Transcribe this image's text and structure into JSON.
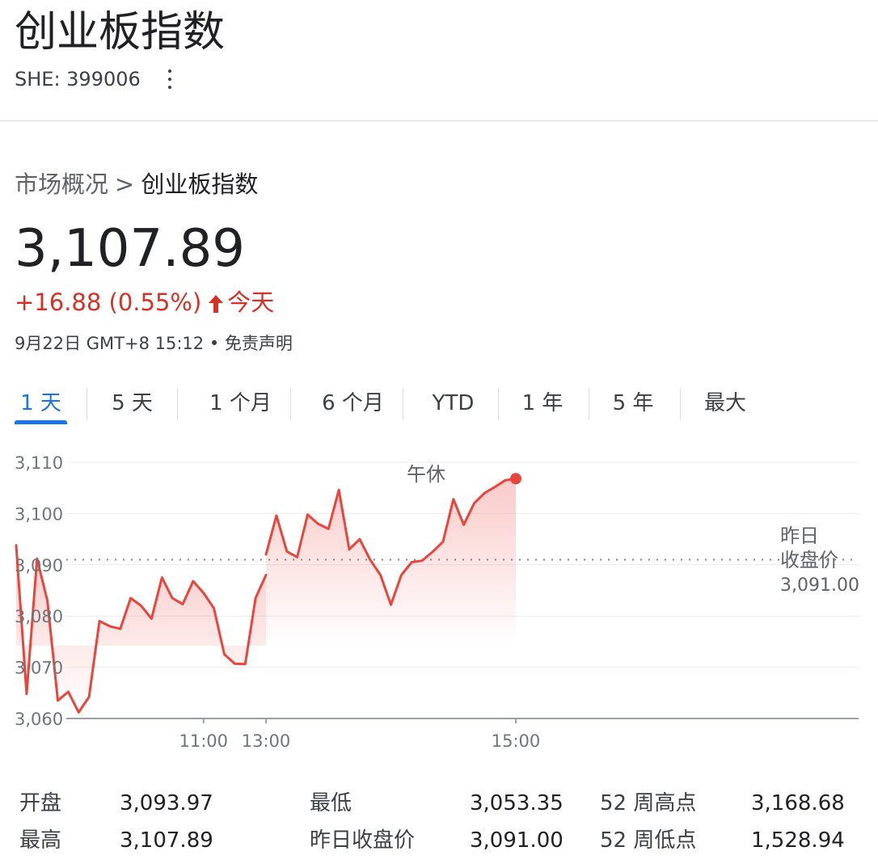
{
  "header": {
    "title": "创业板指数",
    "ticker": "SHE: 399006"
  },
  "breadcrumb": {
    "parent": "市场概况",
    "separator": ">",
    "current": "创业板指数"
  },
  "quote": {
    "price": "3,107.89",
    "change": "+16.88 (0.55%)",
    "period": "今天",
    "timestamp": "9月22日 GMT+8 15:12",
    "bullet": "•",
    "disclaimer": "免责声明"
  },
  "tabs": [
    "1 天",
    "5 天",
    "1 个月",
    "6 个月",
    "YTD",
    "1 年",
    "5 年",
    "最大"
  ],
  "active_tab": 0,
  "colors": {
    "line": "#e8453c",
    "accent": "#1a73e8",
    "negative_text": "#d93025"
  },
  "icons": {
    "menu": "more-vertical-icon",
    "change_direction": "arrow-up-icon"
  },
  "chart_data": {
    "type": "line",
    "ylim": [
      3060,
      3110
    ],
    "yticks": [
      3060,
      3070,
      3080,
      3090,
      3100,
      3110
    ],
    "ytick_labels": [
      "3,060",
      "3,070",
      "3,080",
      "3,090",
      "3,100",
      "3,110"
    ],
    "xticks": [
      "11:00",
      "13:00",
      "15:00"
    ],
    "break_label": "午休",
    "baseline": {
      "value": 3091.0,
      "label_line1": "昨日",
      "label_line2": "收盘价",
      "label_value": "3,091.00"
    },
    "series": [
      {
        "session": "morning",
        "x": [
          "09:30",
          "09:35",
          "09:40",
          "09:45",
          "09:50",
          "09:55",
          "10:00",
          "10:05",
          "10:10",
          "10:15",
          "10:20",
          "10:25",
          "10:30",
          "10:35",
          "10:40",
          "10:45",
          "10:50",
          "10:55",
          "11:00",
          "11:05",
          "11:10",
          "11:15",
          "11:20",
          "11:25",
          "11:30"
        ],
        "values": [
          3093.8,
          3064.8,
          3091.2,
          3083.0,
          3063.5,
          3065.2,
          3061.2,
          3064.2,
          3079.0,
          3078.0,
          3077.5,
          3083.5,
          3082.0,
          3079.5,
          3087.5,
          3083.5,
          3082.3,
          3086.8,
          3084.5,
          3081.5,
          3072.5,
          3070.7,
          3070.6,
          3083.5,
          3088.0
        ]
      },
      {
        "session": "afternoon",
        "x": [
          "13:00",
          "13:05",
          "13:10",
          "13:15",
          "13:20",
          "13:25",
          "13:30",
          "13:35",
          "13:40",
          "13:45",
          "13:50",
          "13:55",
          "14:00",
          "14:05",
          "14:10",
          "14:15",
          "14:20",
          "14:25",
          "14:30",
          "14:35",
          "14:40",
          "14:45",
          "14:50",
          "14:55",
          "15:00"
        ],
        "values": [
          3092.0,
          3099.6,
          3092.6,
          3091.5,
          3099.8,
          3098.0,
          3097.0,
          3104.6,
          3093.0,
          3095.0,
          3091.0,
          3088.0,
          3082.2,
          3088.0,
          3090.5,
          3090.8,
          3092.5,
          3094.5,
          3102.8,
          3097.8,
          3102.0,
          3104.0,
          3105.2,
          3106.5,
          3106.8
        ]
      }
    ]
  },
  "stats": [
    [
      {
        "label": "开盘",
        "value": "3,093.97"
      },
      {
        "label": "最低",
        "value": "3,053.35"
      },
      {
        "label": "52 周高点",
        "value": "3,168.68"
      }
    ],
    [
      {
        "label": "最高",
        "value": "3,107.89"
      },
      {
        "label": "昨日收盘价",
        "value": "3,091.00"
      },
      {
        "label": "52 周低点",
        "value": "1,528.94"
      }
    ]
  ]
}
